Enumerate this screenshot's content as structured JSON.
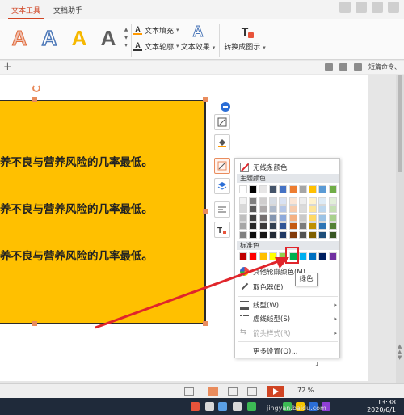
{
  "tabs": {
    "text_tool": "文本工具",
    "doc_helper": "文档助手"
  },
  "ribbon": {
    "wordart_glyph": "A",
    "text_fill": "文本填充",
    "text_outline": "文本轮廓",
    "text_effect": "文本效果",
    "convert_to_picture": "转换成图示"
  },
  "subbar": {
    "add_tab": "+",
    "right_label": "短篇命令、"
  },
  "slide": {
    "lines": [
      "养不良与营养风险的几率最低。",
      "养不良与营养风险的几率最低。",
      "养不良与营养风险的几率最低。"
    ],
    "shape_fill": "#ffc000"
  },
  "panel": {
    "no_outline": "无线条颜色",
    "theme_colors_title": "主题颜色",
    "theme_colors": [
      [
        "#ffffff",
        "#000000",
        "#e7e6e6",
        "#44546a",
        "#4472c4",
        "#ed7d31",
        "#a5a5a5",
        "#ffc000",
        "#5b9bd5",
        "#70ad47"
      ],
      [
        "#f2f2f2",
        "#7f7f7f",
        "#d0cece",
        "#d6dce4",
        "#d9e2f3",
        "#fbe5d5",
        "#ededed",
        "#fff2cc",
        "#deebf6",
        "#e2efd9"
      ],
      [
        "#d8d8d8",
        "#595959",
        "#aeaaaa",
        "#adb9ca",
        "#b4c6e7",
        "#f7cbac",
        "#dbdbdb",
        "#fee599",
        "#bdd7ee",
        "#c5e0b3"
      ],
      [
        "#bfbfbf",
        "#3f3f3f",
        "#757070",
        "#8496b0",
        "#8eaadb",
        "#f4b183",
        "#c9c9c9",
        "#ffd965",
        "#9cc3e5",
        "#a8d08d"
      ],
      [
        "#a5a5a5",
        "#262626",
        "#3a3838",
        "#323f4f",
        "#2f5496",
        "#c55a11",
        "#7b7b7b",
        "#bf9000",
        "#2e75b5",
        "#538135"
      ],
      [
        "#7f7f7f",
        "#0c0c0c",
        "#171616",
        "#222a35",
        "#1f3864",
        "#833c0b",
        "#525252",
        "#7f6000",
        "#1e4e79",
        "#375623"
      ]
    ],
    "standard_colors_title": "标准色",
    "standard_colors": [
      "#c00000",
      "#ff0000",
      "#ffc000",
      "#ffff00",
      "#92d050",
      "#00b050",
      "#00b0f0",
      "#0070c0",
      "#002060",
      "#7030a0"
    ],
    "more_outline_colors": "其他轮廓颜色(M)...",
    "eyedropper": "取色器(E)",
    "line_style": "线型(W)",
    "dash_style": "虚线线型(S)",
    "arrow_style": "箭头样式(R)",
    "more_settings": "更多设置(O)...",
    "tooltip": "绿色",
    "page_num": "1"
  },
  "statusbar": {
    "zoom": "72 %"
  },
  "taskbar": {
    "time": "13:38",
    "date": "2020/6/1"
  },
  "watermark": "jingyan.baidu.com",
  "annotation": {
    "arrow_color": "#e0252b"
  }
}
